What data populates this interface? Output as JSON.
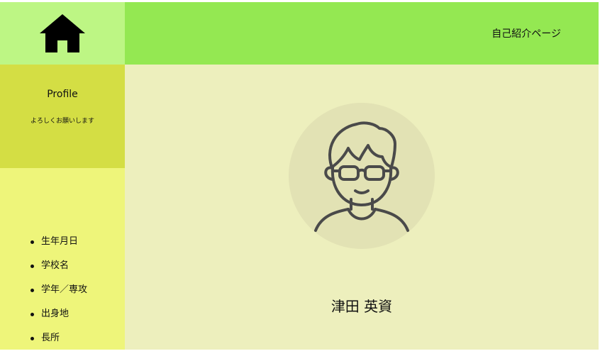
{
  "nav": {
    "home_icon": "home-icon"
  },
  "header": {
    "title": "自己紹介ページ"
  },
  "sidebar": {
    "profile_title": "Profile",
    "profile_subtitle": "よろしくお願いします",
    "items": [
      {
        "label": "生年月日"
      },
      {
        "label": "学校名"
      },
      {
        "label": "学年／専攻"
      },
      {
        "label": "出身地"
      },
      {
        "label": "長所"
      }
    ]
  },
  "main": {
    "avatar_icon": "person-avatar-icon",
    "name": "津田 英資"
  },
  "colors": {
    "home_bg": "#bdf684",
    "header_bg": "#94e852",
    "profile_bg": "#d4de44",
    "nav_bg": "#eef57a",
    "main_bg": "#edefbd",
    "avatar_bg": "#e2e2b4"
  }
}
